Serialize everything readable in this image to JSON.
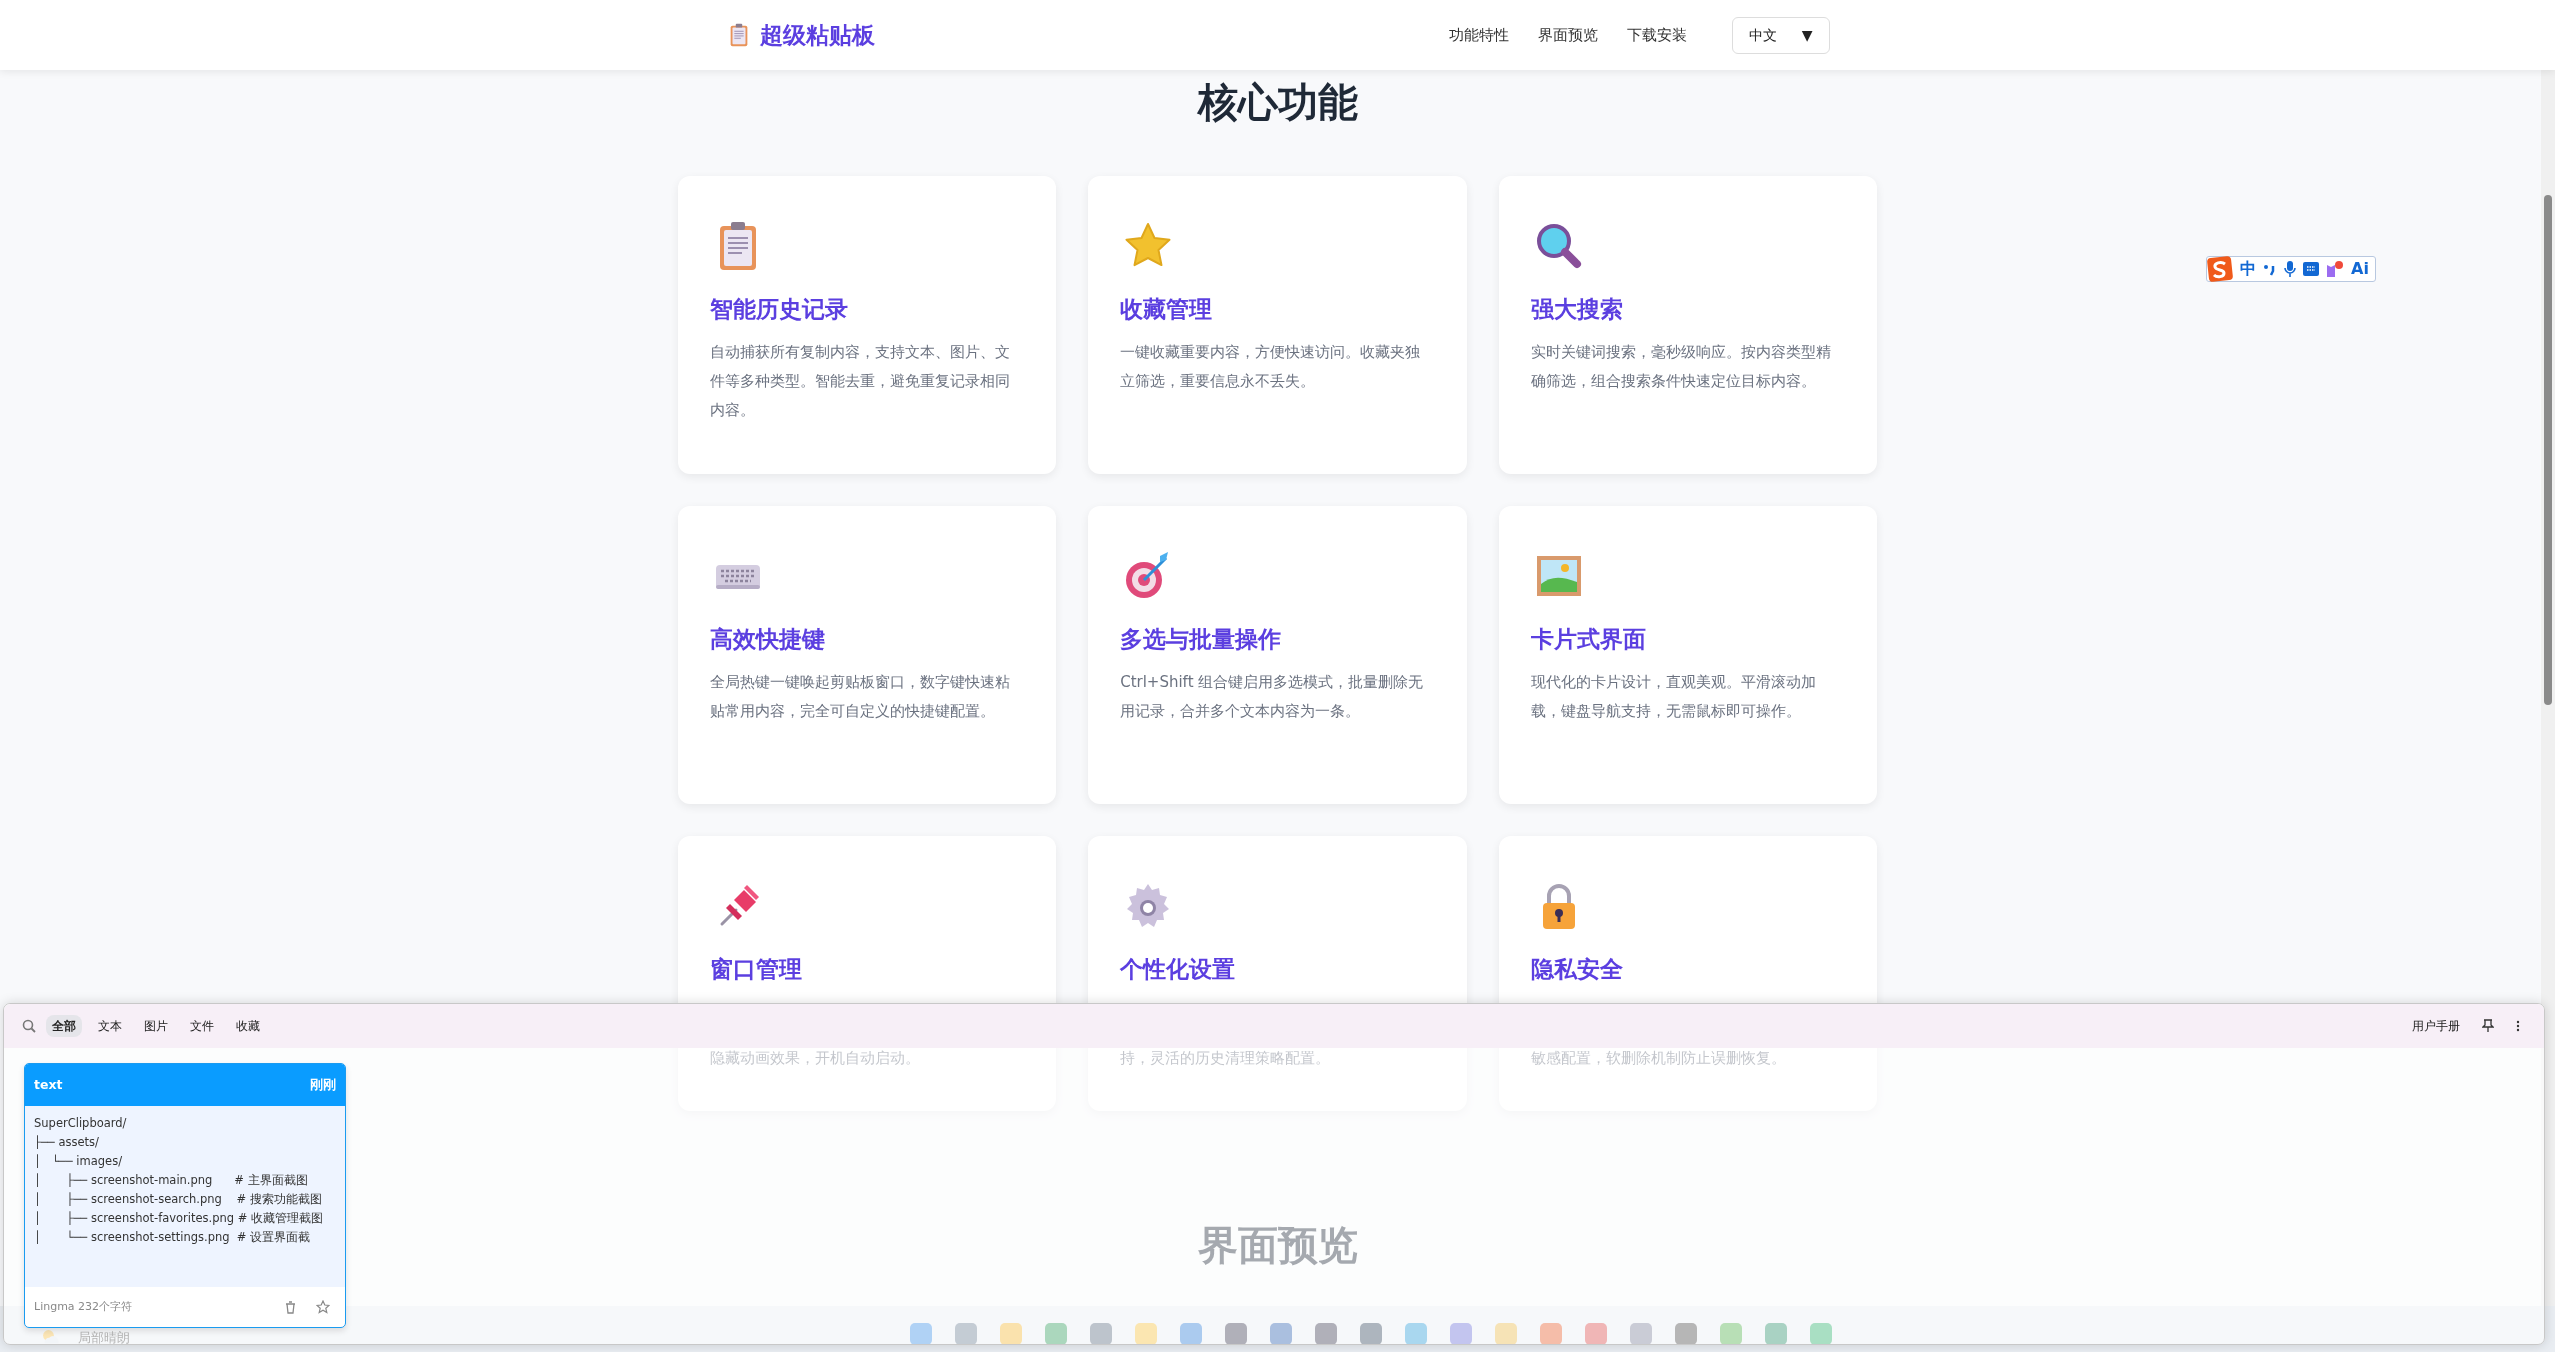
{
  "navbar": {
    "brand": "超级粘贴板",
    "links": [
      "功能特性",
      "界面预览",
      "下载安装"
    ],
    "language": {
      "value": "中文",
      "caret": "▼"
    }
  },
  "section": {
    "title": "核心功能"
  },
  "features": [
    {
      "title": "智能历史记录",
      "description": "自动捕获所有复制内容，支持文本、图片、文件等多种类型。智能去重，避免重复记录相同内容。",
      "cut_above": false
    },
    {
      "title": "收藏管理",
      "description": "一键收藏重要内容，方便快速访问。收藏夹独立筛选，重要信息永不丢失。",
      "cut_above": false
    },
    {
      "title": "强大搜索",
      "description": "实时关键词搜索，毫秒级响应。按内容类型精确筛选，组合搜索条件快速定位目标内容。",
      "cut_above": false
    },
    {
      "title": "高效快捷键",
      "description": "全局热键一键唤起剪贴板窗口，数字键快速粘贴常用内容，完全可自定义的快捷键配置。",
      "cut_above": false
    },
    {
      "title": "多选与批量操作",
      "description": "Ctrl+Shift 组合键启用多选模式，批量删除无用记录，合并多个文本内容为一条。",
      "cut_above": false
    },
    {
      "title": "卡片式界面",
      "description": "现代化的卡片设计，直观美观。平滑滚动加载，键盘导航支持，无需鼠标即可操作。",
      "cut_above": false
    },
    {
      "title": "窗口管理",
      "description": "隐藏动画效果，开机自动启动。",
      "cut_above": true
    },
    {
      "title": "个性化设置",
      "description": "持，灵活的历史清理策略配置。",
      "cut_above": true
    },
    {
      "title": "隐私安全",
      "description": "敏感配置，软删除机制防止误删恢复。",
      "cut_above": true
    }
  ],
  "next_section": {
    "title": "界面预览"
  },
  "ime_toolbar": {
    "mode": "中",
    "ai": "Ai"
  },
  "clipboard_panel": {
    "filters": [
      {
        "label": "全部",
        "selected": true
      },
      {
        "label": "文本",
        "selected": false
      },
      {
        "label": "图片",
        "selected": false
      },
      {
        "label": "文件",
        "selected": false
      },
      {
        "label": "收藏",
        "selected": false
      }
    ],
    "manual": "用户手册",
    "items": [
      {
        "type": "text",
        "time": "刚刚",
        "content": "SuperClipboard/\n├── assets/\n│   └── images/\n│       ├── screenshot-main.png      # 主界面截图\n│       ├── screenshot-search.png    # 搜索功能截图\n│       ├── screenshot-favorites.png # 收藏管理截图\n│       └── screenshot-settings.png  # 设置界面截",
        "source": "Lingma 232个字符",
        "favorite": false
      }
    ]
  },
  "taskbar": {
    "weather": "局部晴朗"
  }
}
